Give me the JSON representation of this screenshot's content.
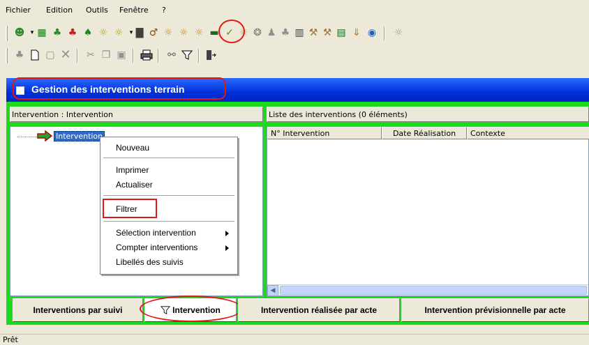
{
  "menu": {
    "items": [
      "Fichier",
      "Edition",
      "Outils",
      "Fenêtre",
      "?"
    ]
  },
  "window": {
    "title": "Gestion des interventions terrain"
  },
  "tree_pane": {
    "header": "Intervention : Intervention",
    "root_label": "Intervention"
  },
  "list_pane": {
    "header": "Liste des interventions  (0 éléments)",
    "columns": [
      "N° Intervention",
      "Date Réalisation",
      "Contexte"
    ]
  },
  "context_menu": {
    "items": [
      "Nouveau",
      "Imprimer",
      "Actualiser",
      "Filtrer",
      "Sélection intervention",
      "Compter interventions",
      "Libellés des suivis"
    ]
  },
  "tabs": [
    "Interventions par suivi",
    "Intervention",
    "Intervention réalisée par acte",
    "Intervention prévisionnelle par acte"
  ],
  "status": {
    "text": "Prêt"
  },
  "colors": {
    "titlebar": "#0030d8",
    "frame": "#1fd91f",
    "highlight_ring": "#e01818"
  }
}
